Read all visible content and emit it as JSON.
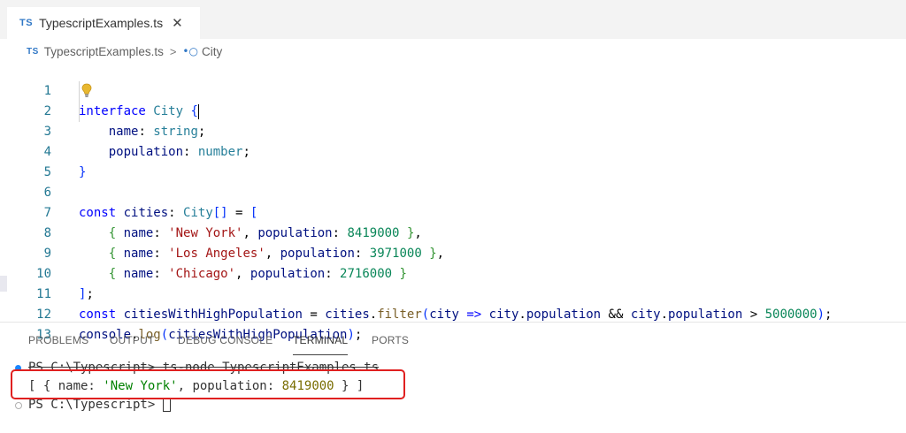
{
  "tab": {
    "badge": "TS",
    "filename": "TypescriptExamples.ts",
    "close_glyph": "✕"
  },
  "breadcrumb": {
    "badge": "TS",
    "file": "TypescriptExamples.ts",
    "separator": ">",
    "symbol_glyph": "•○",
    "symbol": "City"
  },
  "editor": {
    "line_numbers": [
      "1",
      "2",
      "3",
      "4",
      "5",
      "6",
      "7",
      "8",
      "9",
      "10",
      "11",
      "12",
      "13"
    ],
    "lines": [
      "interface City {",
      "    name: string;",
      "    population: number;",
      "}",
      "",
      "const cities: City[] = [",
      "    { name: 'New York', population: 8419000 },",
      "    { name: 'Los Angeles', population: 3971000 },",
      "    { name: 'Chicago', population: 2716000 }",
      "];",
      "const citiesWithHighPopulation = cities.filter(city => city.population && city.population > 5000000);",
      "console.log(citiesWithHighPopulation);",
      ""
    ],
    "icons": [
      "lightbulb-icon"
    ]
  },
  "panel": {
    "tabs": [
      "PROBLEMS",
      "OUTPUT",
      "DEBUG CONSOLE",
      "TERMINAL",
      "PORTS"
    ],
    "active_tab": "TERMINAL"
  },
  "terminal": {
    "lines": [
      "PS C:\\Typescript> ts-node TypescriptExamples.ts",
      "[ { name: 'New York', population: 8419000 } ]",
      "PS C:\\Typescript> "
    ]
  },
  "colors": {
    "highlight_box": "#e02020",
    "ts_blue": "#3178c6",
    "line_number": "#237893",
    "keyword": "#0000ff"
  }
}
